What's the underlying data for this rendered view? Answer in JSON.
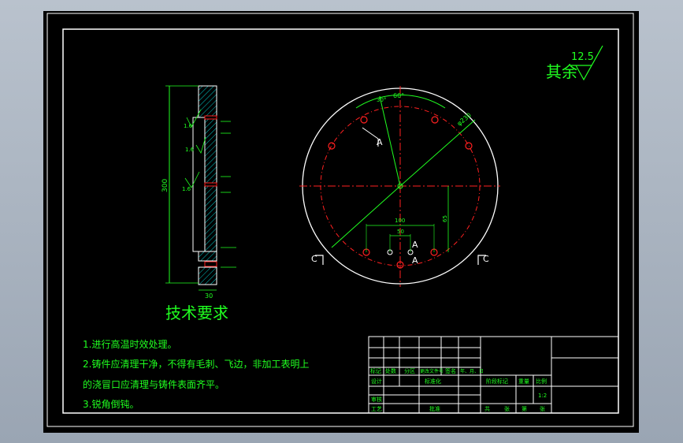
{
  "colors": {
    "frame": "#ffffff",
    "part_outline": "#ffffff",
    "center_lines": "#ff2020",
    "dimensions": "#20ff20",
    "hatch": "#00c8c8",
    "background": "#000000",
    "viewport_bg": "#b0bac6"
  },
  "roughness": {
    "label": "其余",
    "value": "12.5"
  },
  "tech_requirements": {
    "title": "技术要求",
    "items": [
      "1.进行高温时效处理。",
      "2.铸件应清理干净，不得有毛刺、飞边，非加工表明上",
      "的浇冒口应清理与铸件表面齐平。",
      "3.锐角倒钝。"
    ]
  },
  "section_view": {
    "height_dim": "300",
    "bottom_dim": "30",
    "roughness_marks": [
      "1.6",
      "1.6",
      "1.6"
    ]
  },
  "plan_view": {
    "angle_dim": "60°",
    "angle_dim_small": "30°",
    "diameter_dim": "φ230",
    "horizontal_dim_1": "100",
    "horizontal_dim_2": "50",
    "vertical_dim": "65",
    "section_label_a": "A",
    "section_label_c": "C"
  },
  "title_block": {
    "row_labels": [
      "标记",
      "处数",
      "分区",
      "更改文件号",
      "签名",
      "年、月、日"
    ],
    "design": "设计",
    "standardization": "标准化",
    "stage_mark": "阶段标记",
    "weight": "重量",
    "scale": "比例",
    "scale_value": "1:2",
    "review": "审核",
    "process": "工艺",
    "approve": "批准",
    "sheets": [
      "共",
      "张",
      "第",
      "张"
    ]
  }
}
